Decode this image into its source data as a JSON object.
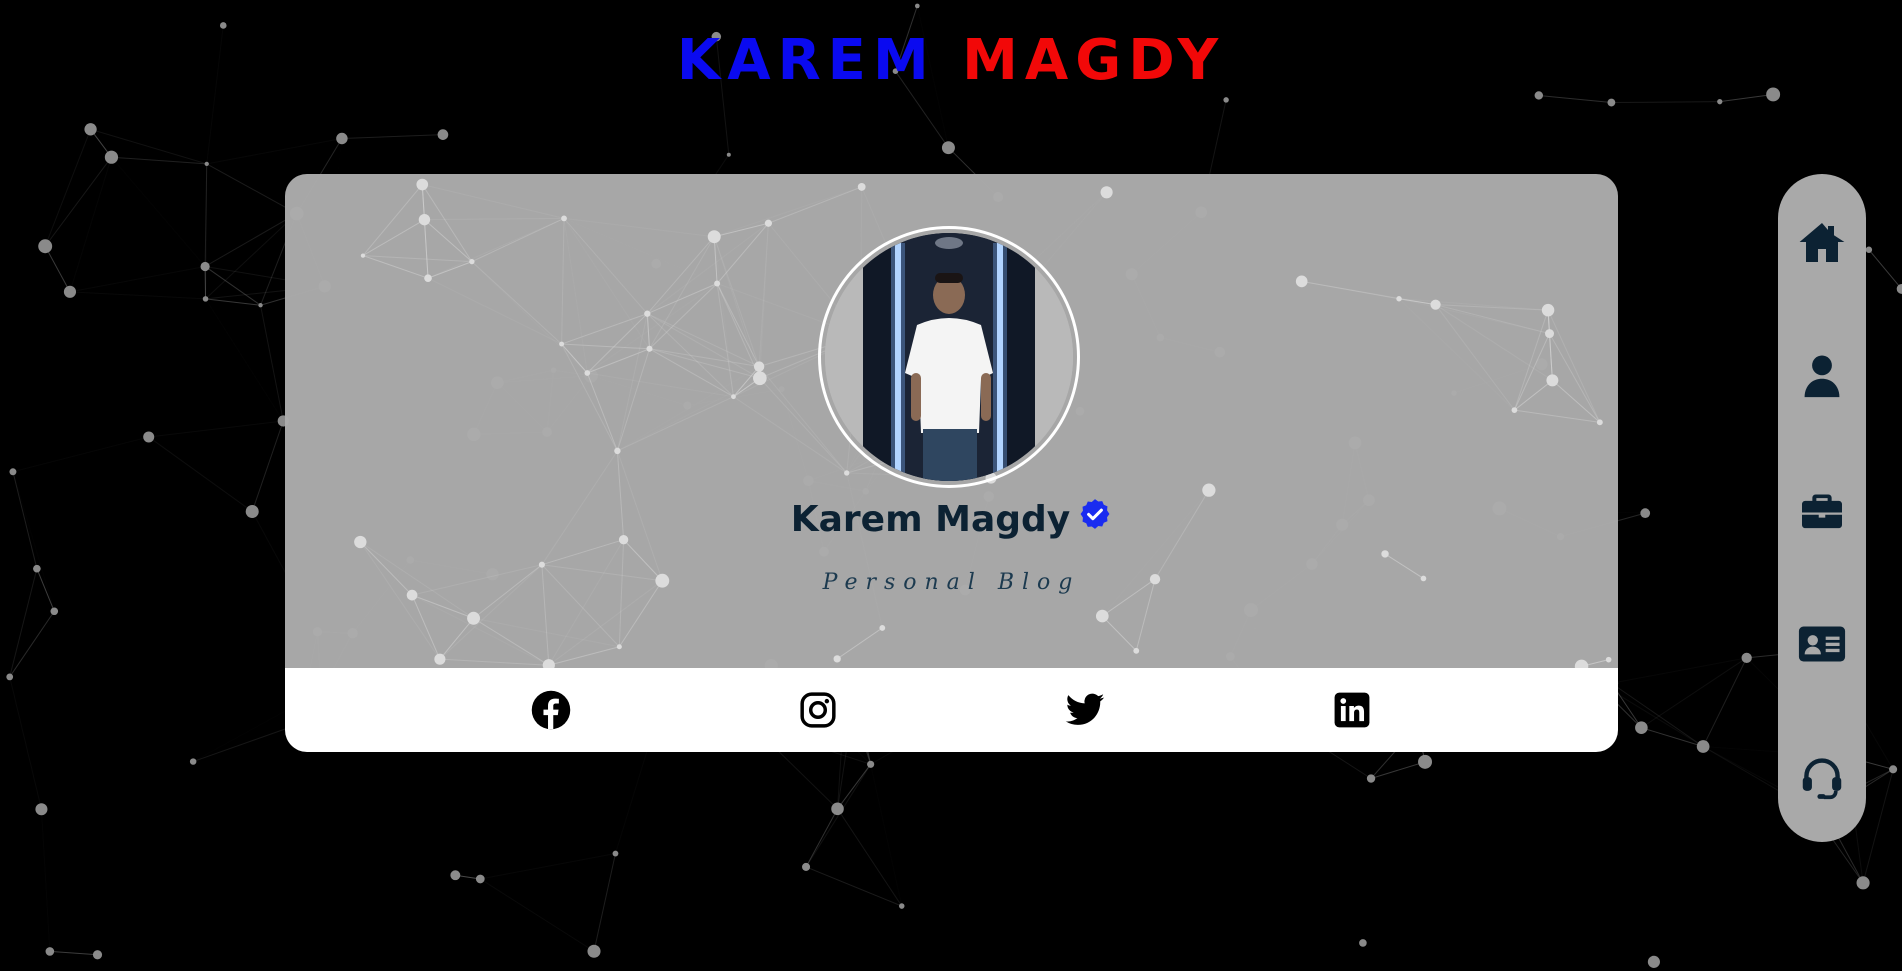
{
  "header": {
    "title_first": "KAREM",
    "title_last": "MAGDY",
    "title_first_color": "#0a0af0",
    "title_last_color": "#f20808"
  },
  "profile": {
    "name": "Karem Magdy",
    "verified_icon": "verified-badge-icon",
    "subtitle": "Personal Blog",
    "avatar_alt": "avatar-photo"
  },
  "social": [
    {
      "name": "facebook",
      "icon": "facebook-icon"
    },
    {
      "name": "instagram",
      "icon": "instagram-icon"
    },
    {
      "name": "twitter",
      "icon": "twitter-icon"
    },
    {
      "name": "linkedin",
      "icon": "linkedin-icon"
    }
  ],
  "side_nav": [
    {
      "name": "home",
      "icon": "home-icon"
    },
    {
      "name": "about",
      "icon": "user-icon"
    },
    {
      "name": "portfolio",
      "icon": "briefcase-icon"
    },
    {
      "name": "resume",
      "icon": "id-card-icon"
    },
    {
      "name": "contact",
      "icon": "headset-icon"
    }
  ],
  "colors": {
    "page_background": "#000000",
    "card_background": "#acacac",
    "social_bar_background": "#ffffff",
    "name_color": "#0c2233",
    "verified_color": "#1a2cf0",
    "nav_background": "#a9a9a9",
    "icon_color": "#0c2233"
  }
}
